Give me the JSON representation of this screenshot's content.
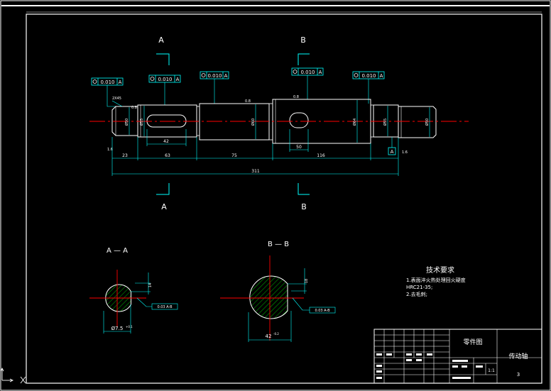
{
  "drawing": {
    "section_markers": {
      "a_top": "A",
      "a_bottom": "A",
      "b_top": "B",
      "b_bottom": "B"
    },
    "tolerance_frames": [
      {
        "value": "0.010",
        "datum": "A"
      },
      {
        "value": "0.010",
        "datum": "A"
      },
      {
        "value": "0.010",
        "datum": "A"
      },
      {
        "value": "0.010",
        "datum": "A"
      },
      {
        "value": "0.010",
        "datum": "A"
      }
    ],
    "datum_box": "A",
    "chamfer_label": "2X45",
    "dimensions": {
      "seg_1": "23",
      "key_len_1": "42",
      "seg_2": "63",
      "seg_3": "75",
      "key_len_2": "50",
      "seg_4": "116",
      "total_length": "311"
    },
    "sections": {
      "aa_title": "A — A",
      "bb_title": "B — B",
      "aa_diameter": "Ø7.5",
      "aa_diameter_tol": "+0.1",
      "bb_diameter": "42",
      "bb_diameter_tol": "-0.2",
      "aa_flatness": "0.03 A-B",
      "bb_flatness": "0.03 A-B"
    },
    "notes": {
      "title": "技术要求",
      "line1": "1.表面淬火热处理回火硬度",
      "line1b": "HRC21-35;",
      "line2": "2.去毛刺;"
    },
    "title_block": {
      "drawing_type": "零件图",
      "part_name": "传动轴",
      "scale": "1:1",
      "quantity": "3"
    }
  },
  "colors": {
    "background": "#000000",
    "outline": "#ffffff",
    "geometry": "#00ffff",
    "centerline": "#ff0000",
    "hatch": "#00cc00",
    "dimension": "#00ffff",
    "text": "#ffffff",
    "ucs_icon": "#ffffff"
  },
  "icons": {
    "ucs": "ucs-axis-icon"
  }
}
